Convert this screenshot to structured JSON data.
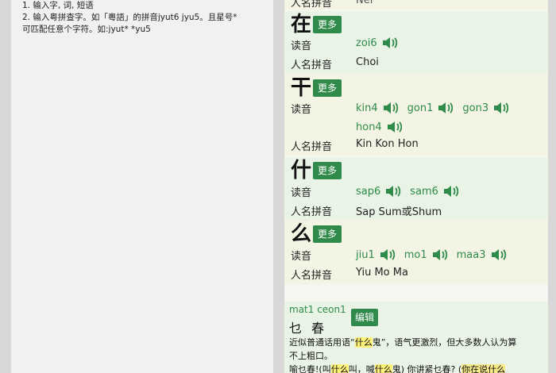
{
  "tips": {
    "line1": "1. 输入字, 词, 短语",
    "line2": "2. 输入粤拼查字。如「粵語」的拼音jyut6  jyu5。且星号*",
    "line3": "可匹配任意个字符。如:jyut*  *yu5"
  },
  "top_partial": {
    "label": "人名拼音",
    "value": "Nei"
  },
  "labels": {
    "reading": "读音",
    "name_pinyin": "人名拼音",
    "more": "更多"
  },
  "entries": [
    {
      "char": "在",
      "readings": [
        "zoi6"
      ],
      "extra_readings": [],
      "names": "Choi"
    },
    {
      "char": "干",
      "readings": [
        "kin4",
        "gon1",
        "gon3"
      ],
      "extra_readings": [
        "hon4"
      ],
      "names": "Kin  Kon  Hon"
    },
    {
      "char": "什",
      "readings": [
        "sap6",
        "sam6"
      ],
      "extra_readings": [],
      "names": "Sap  Sum或Shum"
    },
    {
      "char": "么",
      "readings": [
        "jiu1",
        "mo1",
        "maa3"
      ],
      "extra_readings": [],
      "names": "Yiu  Mo  Ma"
    }
  ],
  "phrase": {
    "roman": "mat1 ceon1",
    "hanzi": "乜春",
    "edit": "编辑",
    "desc_a": "近似普通话用语“",
    "desc_hl": "什么",
    "desc_b": "鬼”，语气更激烈，但大多数人认为算",
    "desc_line2": "不上粗口。",
    "ex_a": "喻乜春!(叫",
    "ex_hl1": "什么",
    "ex_b": "叫，喊",
    "ex_hl2": "什么",
    "ex_c": "鬼) 你讲紧乜春? (",
    "ex_hl3": "你在说什么"
  },
  "colors": {
    "accent": "#2f8a4b",
    "pinyin": "#2e8b4a",
    "highlight": "#fff27a"
  },
  "icon": "speaker-icon"
}
